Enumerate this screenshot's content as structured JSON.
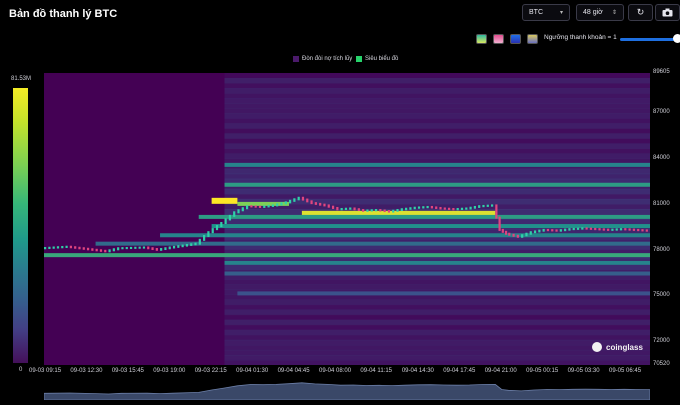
{
  "header": {
    "title": "Bản đồ thanh lý BTC",
    "symbol_select": "BTC",
    "range_select": "48 giờ",
    "refresh_icon": "refresh-icon",
    "camera_icon": "camera-icon"
  },
  "controls": {
    "swatches": [
      "#2fb8a0",
      "#e34d8f",
      "#1f6fe8",
      "#d8c860"
    ],
    "threshold_label": "Ngưỡng thanh khoản = 1",
    "threshold_value": 1
  },
  "chart_data": {
    "type": "heatmap",
    "legend": [
      {
        "name": "Đòn đòi nợ tích lũy",
        "color": "#4b1a6b"
      },
      {
        "name": "Siêu biểu đồ",
        "color": "#27d36b"
      }
    ],
    "colorbar": {
      "max_label": "81.53M",
      "min_label": "0",
      "max": 81.53,
      "min": 0
    },
    "y_ticks": [
      89605,
      87000,
      84000,
      81000,
      78000,
      75000,
      72000,
      70520
    ],
    "ylim": [
      70520,
      89605
    ],
    "x_ticks": [
      "09-03 09:15",
      "09-03 12:30",
      "09-03 15:45",
      "09-03 19:00",
      "09-03 22:15",
      "09-04 01:30",
      "09-04 04:45",
      "09-04 08:00",
      "09-04 11:15",
      "09-04 14:30",
      "09-04 17:45",
      "09-04 21:00",
      "09-05 00:15",
      "09-05 03:30",
      "09-05 06:45"
    ],
    "price_path": [
      [
        0,
        78150
      ],
      [
        2,
        78250
      ],
      [
        4,
        78050
      ],
      [
        5,
        77950
      ],
      [
        6,
        78150
      ],
      [
        8,
        78200
      ],
      [
        9,
        78050
      ],
      [
        10,
        78200
      ],
      [
        12,
        78450
      ],
      [
        13,
        79200
      ],
      [
        14,
        79800
      ],
      [
        15,
        80500
      ],
      [
        16,
        80900
      ],
      [
        17,
        80850
      ],
      [
        18,
        80950
      ],
      [
        19,
        81150
      ],
      [
        20,
        81450
      ],
      [
        21,
        81100
      ],
      [
        22,
        80950
      ],
      [
        23,
        80700
      ],
      [
        24,
        80750
      ],
      [
        25,
        80600
      ],
      [
        26,
        80650
      ],
      [
        27,
        80550
      ],
      [
        28,
        80700
      ],
      [
        29,
        80800
      ],
      [
        30,
        80850
      ],
      [
        31,
        80750
      ],
      [
        32,
        80700
      ],
      [
        33,
        80750
      ],
      [
        34,
        80900
      ],
      [
        35,
        80950
      ],
      [
        35.5,
        79350
      ],
      [
        36,
        79100
      ],
      [
        37,
        78900
      ],
      [
        38,
        79200
      ],
      [
        39,
        79350
      ],
      [
        40,
        79300
      ],
      [
        41,
        79400
      ],
      [
        42,
        79450
      ],
      [
        43,
        79400
      ],
      [
        44,
        79350
      ],
      [
        45,
        79400
      ],
      [
        46,
        79350
      ],
      [
        47,
        79300
      ]
    ],
    "liquidity_bands": [
      {
        "price": 81250,
        "from": 13,
        "to": 15,
        "intensity": 1.0
      },
      {
        "price": 81050,
        "from": 15,
        "to": 19,
        "intensity": 0.8
      },
      {
        "price": 80400,
        "from": 20,
        "to": 35,
        "intensity": 0.95
      },
      {
        "price": 80200,
        "from": 12,
        "to": 47,
        "intensity": 0.55
      },
      {
        "price": 79600,
        "from": 13,
        "to": 47,
        "intensity": 0.5
      },
      {
        "price": 79000,
        "from": 9,
        "to": 47,
        "intensity": 0.45
      },
      {
        "price": 78450,
        "from": 4,
        "to": 47,
        "intensity": 0.35
      },
      {
        "price": 77700,
        "from": 0,
        "to": 47,
        "intensity": 0.6
      },
      {
        "price": 77200,
        "from": 14,
        "to": 47,
        "intensity": 0.45
      },
      {
        "price": 82300,
        "from": 14,
        "to": 47,
        "intensity": 0.55
      },
      {
        "price": 83600,
        "from": 14,
        "to": 47,
        "intensity": 0.45
      },
      {
        "price": 76500,
        "from": 14,
        "to": 47,
        "intensity": 0.3
      },
      {
        "price": 75200,
        "from": 15,
        "to": 47,
        "intensity": 0.25
      }
    ],
    "x_range_hours": [
      0,
      47
    ]
  },
  "watermark": "coinglass"
}
